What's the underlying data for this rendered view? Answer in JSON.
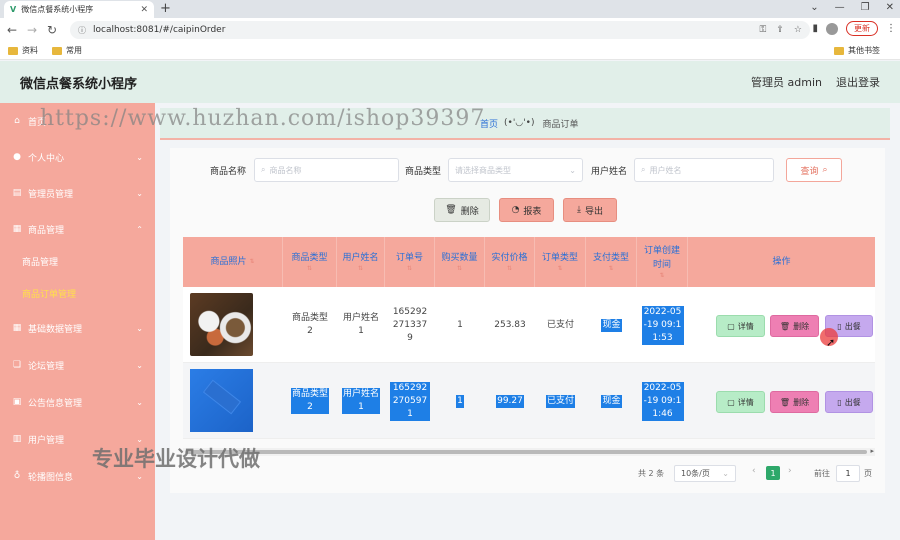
{
  "browser": {
    "tab_title": "微信点餐系统小程序",
    "url": "localhost:8081/#/caipinOrder",
    "update_label": "更新",
    "bookmarks": [
      "资料",
      "常用"
    ],
    "other_bookmarks": "其他书签"
  },
  "header": {
    "title": "微信点餐系统小程序",
    "user": "管理员 admin",
    "logout": "退出登录"
  },
  "sidebar": {
    "items": [
      {
        "label": "首页"
      },
      {
        "label": "个人中心"
      },
      {
        "label": "管理员管理"
      },
      {
        "label": "商品管理"
      },
      {
        "label": "基础数据管理"
      },
      {
        "label": "论坛管理"
      },
      {
        "label": "公告信息管理"
      },
      {
        "label": "用户管理"
      },
      {
        "label": "轮播图信息"
      }
    ],
    "sub_items": [
      {
        "label": "商品管理"
      },
      {
        "label": "商品订单管理"
      }
    ]
  },
  "breadcrumb": {
    "home": "首页",
    "face": "(•'◡'•)",
    "current": "商品订单"
  },
  "filters": {
    "name_label": "商品名称",
    "name_placeholder": "商品名称",
    "type_label": "商品类型",
    "type_placeholder": "请选择商品类型",
    "user_label": "用户姓名",
    "user_placeholder": "用户姓名",
    "query_label": "查询"
  },
  "actions": {
    "delete": "删除",
    "report": "报表",
    "export": "导出"
  },
  "table": {
    "columns": [
      "商品照片",
      "商品类型",
      "用户姓名",
      "订单号",
      "购买数量",
      "实付价格",
      "订单类型",
      "支付类型",
      "订单创建时间",
      "操作"
    ],
    "rows": [
      {
        "type": "商品类型2",
        "user": "用户姓名1",
        "order_no": "1652922713379",
        "qty": "1",
        "price": "253.83",
        "order_type": "已支付",
        "pay_type": "现金",
        "created": "2022-05-19 09:11:53"
      },
      {
        "type": "商品类型2",
        "user": "用户姓名1",
        "order_no": "1652922705971",
        "qty": "1",
        "price": "99.27",
        "order_type": "已支付",
        "pay_type": "现金",
        "created": "2022-05-19 09:11:46"
      }
    ],
    "row_actions": {
      "detail": "详情",
      "delete": "删除",
      "serve": "出餐"
    }
  },
  "pagination": {
    "total": "共 2 条",
    "page_size": "10条/页",
    "current": "1",
    "goto_label": "前往",
    "goto_value": "1",
    "page_unit": "页"
  },
  "watermarks": {
    "url": "https://www.huzhan.com/ishop39397",
    "text": "专业毕业设计代做"
  }
}
